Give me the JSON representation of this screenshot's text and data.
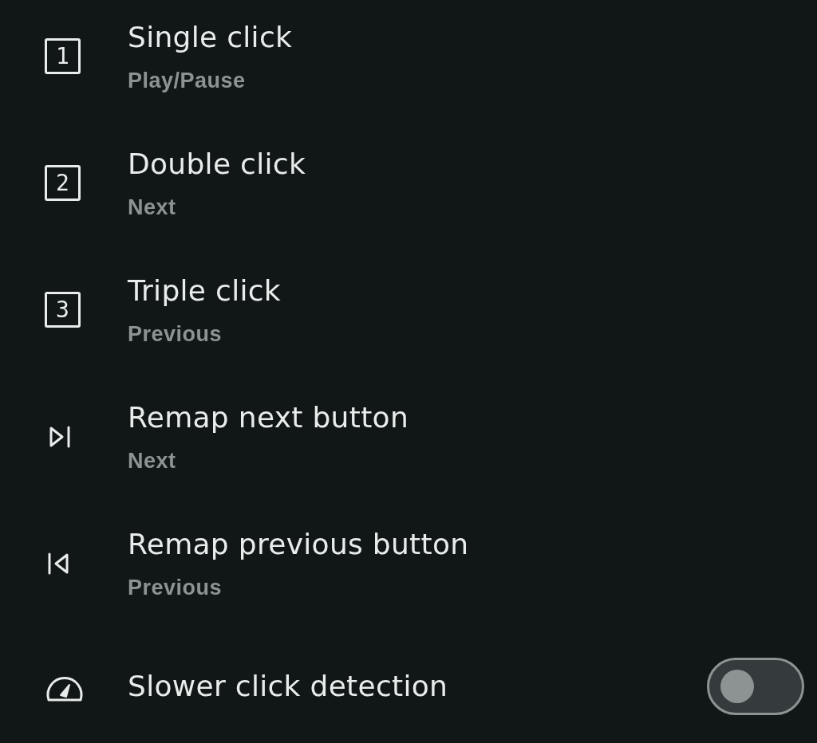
{
  "items": [
    {
      "kind": "number",
      "badge": "1",
      "title": "Single click",
      "subtitle": "Play/Pause"
    },
    {
      "kind": "number",
      "badge": "2",
      "title": "Double click",
      "subtitle": "Next"
    },
    {
      "kind": "number",
      "badge": "3",
      "title": "Triple click",
      "subtitle": "Previous"
    },
    {
      "kind": "next",
      "title": "Remap next button",
      "subtitle": "Next"
    },
    {
      "kind": "previous",
      "title": "Remap previous button",
      "subtitle": "Previous"
    },
    {
      "kind": "toggle",
      "title": "Slower click detection",
      "on": false
    }
  ]
}
